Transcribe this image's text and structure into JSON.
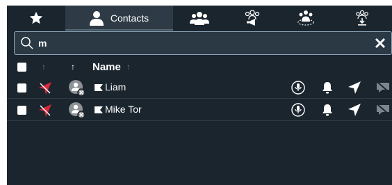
{
  "tabs": [
    {
      "name": "favorites",
      "icon": "star-icon"
    },
    {
      "name": "contacts",
      "label": "Contacts",
      "icon": "person-icon",
      "active": true
    },
    {
      "name": "groups",
      "icon": "group-icon"
    },
    {
      "name": "broadcast-group",
      "icon": "group-broadcast-icon"
    },
    {
      "name": "group-radius",
      "icon": "group-radius-icon"
    },
    {
      "name": "group-download",
      "icon": "group-download-icon"
    }
  ],
  "search": {
    "value": "m"
  },
  "table": {
    "name_header": "Name"
  },
  "contacts": [
    {
      "name": "Liam"
    },
    {
      "name": "Mike Tor"
    }
  ],
  "colors": {
    "background": "#1b252e",
    "active_tab": "#2e3b47",
    "accent_red": "#d8283a",
    "muted_grey": "#6b7883"
  }
}
